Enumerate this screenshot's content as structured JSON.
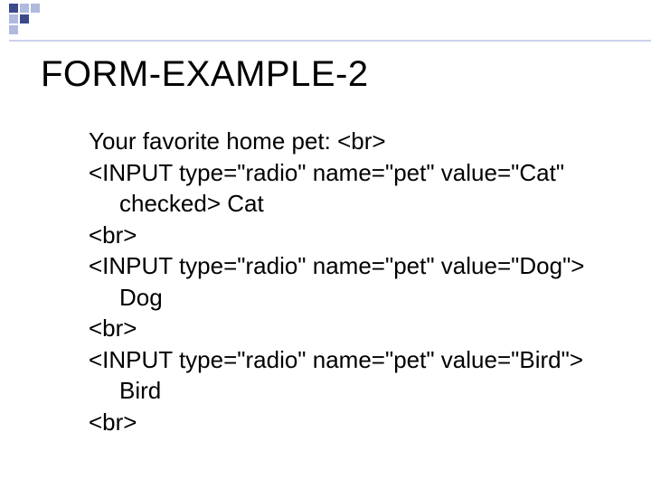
{
  "title": "FORM-EXAMPLE-2",
  "lines": {
    "l1": "Your favorite home pet: <br>",
    "l2": "<INPUT  type=\"radio\"  name=\"pet\"  value=\"Cat\"",
    "l2b": "checked> Cat",
    "l3": "<br>",
    "l4": "<INPUT type=\"radio\" name=\"pet\" value=\"Dog\">",
    "l4b": "Dog",
    "l5": "<br>",
    "l6": "<INPUT type=\"radio\" name=\"pet\" value=\"Bird\">",
    "l6b": "Bird",
    "l7": "<br>"
  }
}
